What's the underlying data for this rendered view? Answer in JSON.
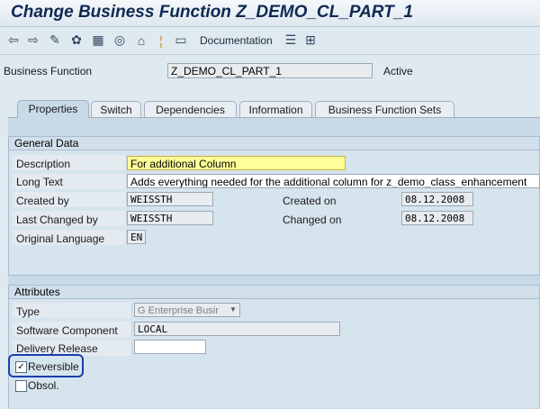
{
  "title": "Change Business Function Z_DEMO_CL_PART_1",
  "toolbar": {
    "icons": [
      "back-arrow-icon",
      "forward-arrow-icon",
      "edit-pencil-icon",
      "display-change-icon",
      "object-list-icon",
      "where-used-icon",
      "hierarchy-icon",
      "info-icon",
      "layout-icon"
    ],
    "documentation_label": "Documentation",
    "extra_icons": [
      "print-icon",
      "structure-icon"
    ]
  },
  "header": {
    "business_function_label": "Business Function",
    "business_function_value": "Z_DEMO_CL_PART_1",
    "status": "Active"
  },
  "tabs": [
    "Properties",
    "Switch",
    "Dependencies",
    "Information",
    "Business Function Sets"
  ],
  "general": {
    "title": "General Data",
    "description_label": "Description",
    "description_value": "For additional Column",
    "long_text_label": "Long Text",
    "long_text_value": "Adds everything needed for the additional column for z_demo_class_enhancement",
    "created_by_label": "Created by",
    "created_by_value": "WEISSTH",
    "created_on_label": "Created on",
    "created_on_value": "08.12.2008",
    "changed_by_label": "Last Changed by",
    "changed_by_value": "WEISSTH",
    "changed_on_label": "Changed on",
    "changed_on_value": "08.12.2008",
    "language_label": "Original Language",
    "language_value": "EN"
  },
  "attributes": {
    "title": "Attributes",
    "type_label": "Type",
    "type_value": "G Enterprise Busir",
    "software_label": "Software Component",
    "software_value": "LOCAL",
    "delivery_label": "Delivery Release",
    "delivery_value": "",
    "reversible_label": "Reversible",
    "reversible_checked": true,
    "obsol_label": "Obsol.",
    "obsol_checked": false
  }
}
